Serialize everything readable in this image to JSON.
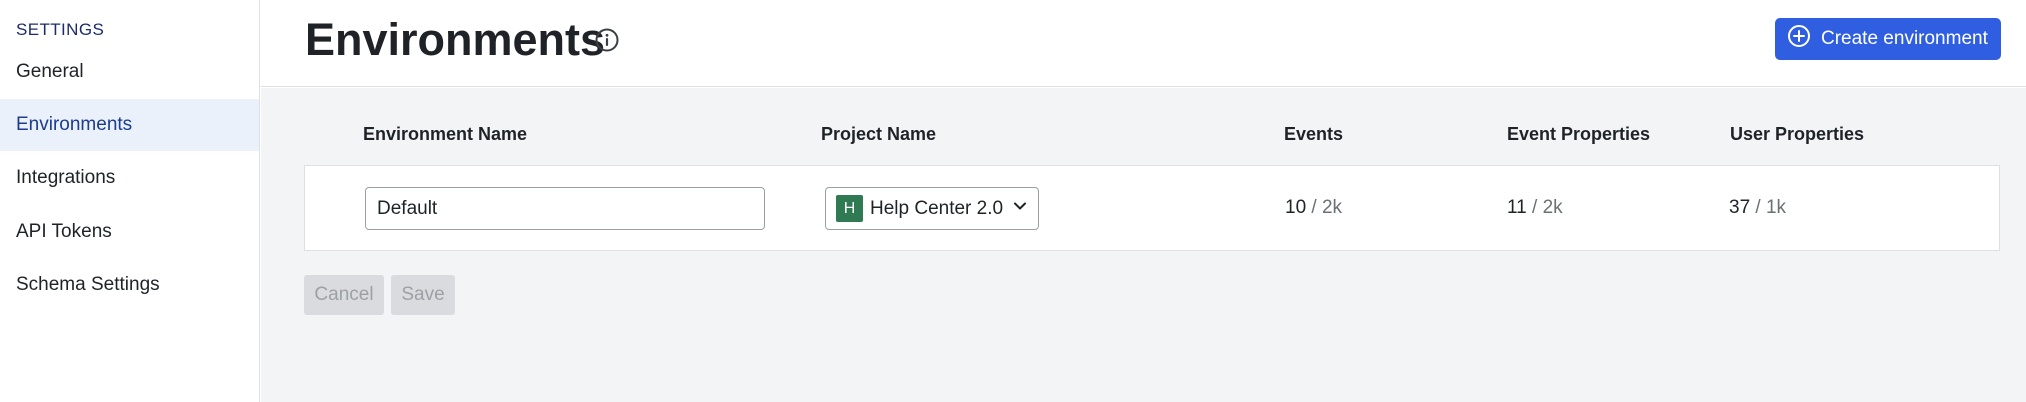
{
  "sidebar": {
    "heading": "SETTINGS",
    "items": [
      {
        "label": "General",
        "active": false
      },
      {
        "label": "Environments",
        "active": true
      },
      {
        "label": "Integrations",
        "active": false
      },
      {
        "label": "API Tokens",
        "active": false
      },
      {
        "label": "Schema Settings",
        "active": false
      }
    ]
  },
  "header": {
    "title": "Environments",
    "info_icon": "info-circle-icon",
    "create_button": {
      "label": "Create environment",
      "icon": "plus-circle-icon"
    }
  },
  "table": {
    "columns": [
      "Environment Name",
      "Project Name",
      "Events",
      "Event Properties",
      "User Properties"
    ],
    "rows": [
      {
        "environment_name": "Default",
        "project": {
          "initial": "H",
          "name": "Help Center 2.0"
        },
        "events": {
          "used": "10",
          "limit": "2k"
        },
        "event_properties": {
          "used": "11",
          "limit": "2k"
        },
        "user_properties": {
          "used": "37",
          "limit": "1k"
        }
      }
    ]
  },
  "actions": {
    "cancel_label": "Cancel",
    "save_label": "Save"
  },
  "colors": {
    "accent": "#2f5fe0",
    "active_nav_bg": "#eaf1fb",
    "project_avatar": "#2f7a53",
    "main_bg": "#f3f4f6"
  }
}
